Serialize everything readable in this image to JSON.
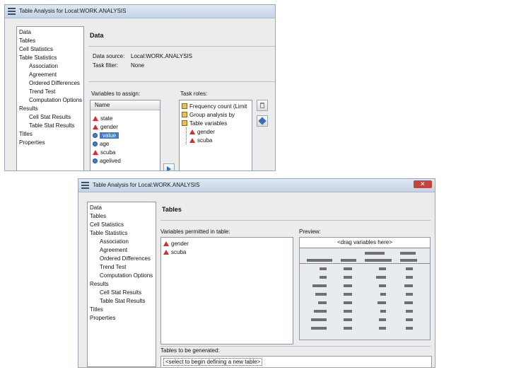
{
  "colors": {
    "title_bar": "#c4d3e6",
    "selection": "#3d7bd6",
    "close_button": "#c9423a",
    "preview_grid": "#e9ecef"
  },
  "window1": {
    "title": "Table Analysis for Local:WORK.ANALYSIS",
    "nav": [
      "Data",
      "Tables",
      "Cell Statistics",
      "Table Statistics",
      "Association",
      "Agreement",
      "Ordered Differences",
      "Trend Test",
      "Computation Options",
      "Results",
      "Cell Stat Results",
      "Table Stat Results",
      "Titles",
      "Properties"
    ],
    "section_title": "Data",
    "data_source_label": "Data source:",
    "data_source_value": "Local:WORK.ANALYSIS",
    "task_filter_label": "Task filter:",
    "task_filter_value": "None",
    "vars_label": "Variables to assign:",
    "vars_header": "Name",
    "vars": [
      {
        "name": "state",
        "icon": "char-icon"
      },
      {
        "name": "gender",
        "icon": "char-icon"
      },
      {
        "name": "value",
        "icon": "numeric-icon",
        "selected": true
      },
      {
        "name": "age",
        "icon": "numeric-icon"
      },
      {
        "name": "scuba",
        "icon": "char-icon"
      },
      {
        "name": "agelived",
        "icon": "numeric-icon"
      }
    ],
    "roles_label": "Task roles:",
    "roles": [
      {
        "name": "Frequency count  (Limit",
        "icon": "role-icon"
      },
      {
        "name": "Group analysis by",
        "icon": "role-icon"
      },
      {
        "name": "Table variables",
        "icon": "table-icon"
      }
    ],
    "role_children": [
      "gender",
      "scuba"
    ]
  },
  "window2": {
    "title": "Table Analysis for Local:WORK.ANALYSIS",
    "nav": [
      "Data",
      "Tables",
      "Cell Statistics",
      "Table Statistics",
      "Association",
      "Agreement",
      "Ordered Differences",
      "Trend Test",
      "Computation Options",
      "Results",
      "Cell Stat Results",
      "Table Stat Results",
      "Titles",
      "Properties"
    ],
    "section_title": "Tables",
    "permitted_label": "Variables permitted in table:",
    "permitted": [
      "gender",
      "scuba"
    ],
    "preview_label": "Preview:",
    "drag_hint": "<drag variables here>",
    "tables_label": "Tables to be generated:",
    "tables_value": "<select to begin defining a new table>"
  }
}
